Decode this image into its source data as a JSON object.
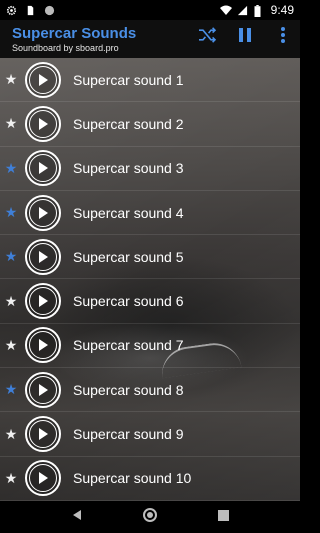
{
  "status_bar": {
    "time": "9:49",
    "left_icons": [
      "gear-icon",
      "sd-card-icon",
      "circle-icon"
    ],
    "right_icons": [
      "wifi-icon",
      "signal-icon",
      "battery-icon"
    ]
  },
  "app_bar": {
    "title": "Supercar Sounds",
    "subtitle": "Soundboard by sboard.pro",
    "accent_color": "#4a8fe6",
    "actions": [
      "shuffle-icon",
      "pause-icon",
      "more-vert-icon"
    ]
  },
  "sounds": [
    {
      "label": "Supercar sound 1",
      "favorite": false
    },
    {
      "label": "Supercar sound 2",
      "favorite": false
    },
    {
      "label": "Supercar sound 3",
      "favorite": true
    },
    {
      "label": "Supercar sound 4",
      "favorite": true
    },
    {
      "label": "Supercar sound 5",
      "favorite": true
    },
    {
      "label": "Supercar sound 6",
      "favorite": false
    },
    {
      "label": "Supercar sound 7",
      "favorite": false
    },
    {
      "label": "Supercar sound 8",
      "favorite": true
    },
    {
      "label": "Supercar sound 9",
      "favorite": false
    },
    {
      "label": "Supercar sound 10",
      "favorite": false
    }
  ],
  "colors": {
    "favorite_star": "#3f7fd8",
    "default_star": "#f0f0f0"
  },
  "nav_bar": {
    "buttons": [
      "back-icon",
      "home-icon",
      "recents-icon"
    ]
  }
}
